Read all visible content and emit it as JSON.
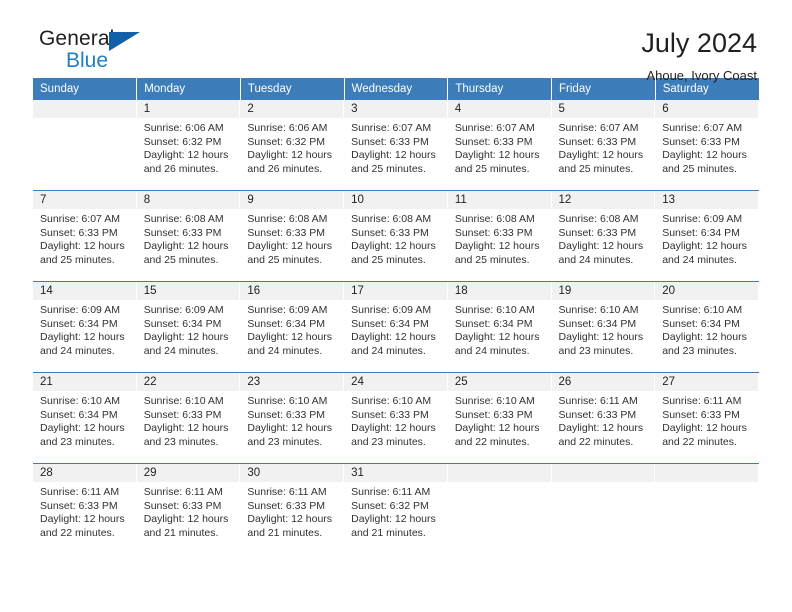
{
  "brand": {
    "name_part1": "General",
    "name_part2": "Blue",
    "triangle_color": "#1260a8",
    "blue_color": "#1f7fc4"
  },
  "header": {
    "title": "July 2024",
    "subtitle": "Ahoue, Ivory Coast",
    "header_bg": "#3b7cb9",
    "daynum_bg": "#f1f1f1"
  },
  "weekdays": [
    "Sunday",
    "Monday",
    "Tuesday",
    "Wednesday",
    "Thursday",
    "Friday",
    "Saturday"
  ],
  "weeks": [
    [
      {
        "day": "",
        "sunrise": "",
        "sunset": "",
        "daylight1": "",
        "daylight2": ""
      },
      {
        "day": "1",
        "sunrise": "Sunrise: 6:06 AM",
        "sunset": "Sunset: 6:32 PM",
        "daylight1": "Daylight: 12 hours",
        "daylight2": "and 26 minutes."
      },
      {
        "day": "2",
        "sunrise": "Sunrise: 6:06 AM",
        "sunset": "Sunset: 6:32 PM",
        "daylight1": "Daylight: 12 hours",
        "daylight2": "and 26 minutes."
      },
      {
        "day": "3",
        "sunrise": "Sunrise: 6:07 AM",
        "sunset": "Sunset: 6:33 PM",
        "daylight1": "Daylight: 12 hours",
        "daylight2": "and 25 minutes."
      },
      {
        "day": "4",
        "sunrise": "Sunrise: 6:07 AM",
        "sunset": "Sunset: 6:33 PM",
        "daylight1": "Daylight: 12 hours",
        "daylight2": "and 25 minutes."
      },
      {
        "day": "5",
        "sunrise": "Sunrise: 6:07 AM",
        "sunset": "Sunset: 6:33 PM",
        "daylight1": "Daylight: 12 hours",
        "daylight2": "and 25 minutes."
      },
      {
        "day": "6",
        "sunrise": "Sunrise: 6:07 AM",
        "sunset": "Sunset: 6:33 PM",
        "daylight1": "Daylight: 12 hours",
        "daylight2": "and 25 minutes."
      }
    ],
    [
      {
        "day": "7",
        "sunrise": "Sunrise: 6:07 AM",
        "sunset": "Sunset: 6:33 PM",
        "daylight1": "Daylight: 12 hours",
        "daylight2": "and 25 minutes."
      },
      {
        "day": "8",
        "sunrise": "Sunrise: 6:08 AM",
        "sunset": "Sunset: 6:33 PM",
        "daylight1": "Daylight: 12 hours",
        "daylight2": "and 25 minutes."
      },
      {
        "day": "9",
        "sunrise": "Sunrise: 6:08 AM",
        "sunset": "Sunset: 6:33 PM",
        "daylight1": "Daylight: 12 hours",
        "daylight2": "and 25 minutes."
      },
      {
        "day": "10",
        "sunrise": "Sunrise: 6:08 AM",
        "sunset": "Sunset: 6:33 PM",
        "daylight1": "Daylight: 12 hours",
        "daylight2": "and 25 minutes."
      },
      {
        "day": "11",
        "sunrise": "Sunrise: 6:08 AM",
        "sunset": "Sunset: 6:33 PM",
        "daylight1": "Daylight: 12 hours",
        "daylight2": "and 25 minutes."
      },
      {
        "day": "12",
        "sunrise": "Sunrise: 6:08 AM",
        "sunset": "Sunset: 6:33 PM",
        "daylight1": "Daylight: 12 hours",
        "daylight2": "and 24 minutes."
      },
      {
        "day": "13",
        "sunrise": "Sunrise: 6:09 AM",
        "sunset": "Sunset: 6:34 PM",
        "daylight1": "Daylight: 12 hours",
        "daylight2": "and 24 minutes."
      }
    ],
    [
      {
        "day": "14",
        "sunrise": "Sunrise: 6:09 AM",
        "sunset": "Sunset: 6:34 PM",
        "daylight1": "Daylight: 12 hours",
        "daylight2": "and 24 minutes."
      },
      {
        "day": "15",
        "sunrise": "Sunrise: 6:09 AM",
        "sunset": "Sunset: 6:34 PM",
        "daylight1": "Daylight: 12 hours",
        "daylight2": "and 24 minutes."
      },
      {
        "day": "16",
        "sunrise": "Sunrise: 6:09 AM",
        "sunset": "Sunset: 6:34 PM",
        "daylight1": "Daylight: 12 hours",
        "daylight2": "and 24 minutes."
      },
      {
        "day": "17",
        "sunrise": "Sunrise: 6:09 AM",
        "sunset": "Sunset: 6:34 PM",
        "daylight1": "Daylight: 12 hours",
        "daylight2": "and 24 minutes."
      },
      {
        "day": "18",
        "sunrise": "Sunrise: 6:10 AM",
        "sunset": "Sunset: 6:34 PM",
        "daylight1": "Daylight: 12 hours",
        "daylight2": "and 24 minutes."
      },
      {
        "day": "19",
        "sunrise": "Sunrise: 6:10 AM",
        "sunset": "Sunset: 6:34 PM",
        "daylight1": "Daylight: 12 hours",
        "daylight2": "and 23 minutes."
      },
      {
        "day": "20",
        "sunrise": "Sunrise: 6:10 AM",
        "sunset": "Sunset: 6:34 PM",
        "daylight1": "Daylight: 12 hours",
        "daylight2": "and 23 minutes."
      }
    ],
    [
      {
        "day": "21",
        "sunrise": "Sunrise: 6:10 AM",
        "sunset": "Sunset: 6:34 PM",
        "daylight1": "Daylight: 12 hours",
        "daylight2": "and 23 minutes."
      },
      {
        "day": "22",
        "sunrise": "Sunrise: 6:10 AM",
        "sunset": "Sunset: 6:33 PM",
        "daylight1": "Daylight: 12 hours",
        "daylight2": "and 23 minutes."
      },
      {
        "day": "23",
        "sunrise": "Sunrise: 6:10 AM",
        "sunset": "Sunset: 6:33 PM",
        "daylight1": "Daylight: 12 hours",
        "daylight2": "and 23 minutes."
      },
      {
        "day": "24",
        "sunrise": "Sunrise: 6:10 AM",
        "sunset": "Sunset: 6:33 PM",
        "daylight1": "Daylight: 12 hours",
        "daylight2": "and 23 minutes."
      },
      {
        "day": "25",
        "sunrise": "Sunrise: 6:10 AM",
        "sunset": "Sunset: 6:33 PM",
        "daylight1": "Daylight: 12 hours",
        "daylight2": "and 22 minutes."
      },
      {
        "day": "26",
        "sunrise": "Sunrise: 6:11 AM",
        "sunset": "Sunset: 6:33 PM",
        "daylight1": "Daylight: 12 hours",
        "daylight2": "and 22 minutes."
      },
      {
        "day": "27",
        "sunrise": "Sunrise: 6:11 AM",
        "sunset": "Sunset: 6:33 PM",
        "daylight1": "Daylight: 12 hours",
        "daylight2": "and 22 minutes."
      }
    ],
    [
      {
        "day": "28",
        "sunrise": "Sunrise: 6:11 AM",
        "sunset": "Sunset: 6:33 PM",
        "daylight1": "Daylight: 12 hours",
        "daylight2": "and 22 minutes."
      },
      {
        "day": "29",
        "sunrise": "Sunrise: 6:11 AM",
        "sunset": "Sunset: 6:33 PM",
        "daylight1": "Daylight: 12 hours",
        "daylight2": "and 21 minutes."
      },
      {
        "day": "30",
        "sunrise": "Sunrise: 6:11 AM",
        "sunset": "Sunset: 6:33 PM",
        "daylight1": "Daylight: 12 hours",
        "daylight2": "and 21 minutes."
      },
      {
        "day": "31",
        "sunrise": "Sunrise: 6:11 AM",
        "sunset": "Sunset: 6:32 PM",
        "daylight1": "Daylight: 12 hours",
        "daylight2": "and 21 minutes."
      },
      {
        "day": "",
        "sunrise": "",
        "sunset": "",
        "daylight1": "",
        "daylight2": ""
      },
      {
        "day": "",
        "sunrise": "",
        "sunset": "",
        "daylight1": "",
        "daylight2": ""
      },
      {
        "day": "",
        "sunrise": "",
        "sunset": "",
        "daylight1": "",
        "daylight2": ""
      }
    ]
  ]
}
